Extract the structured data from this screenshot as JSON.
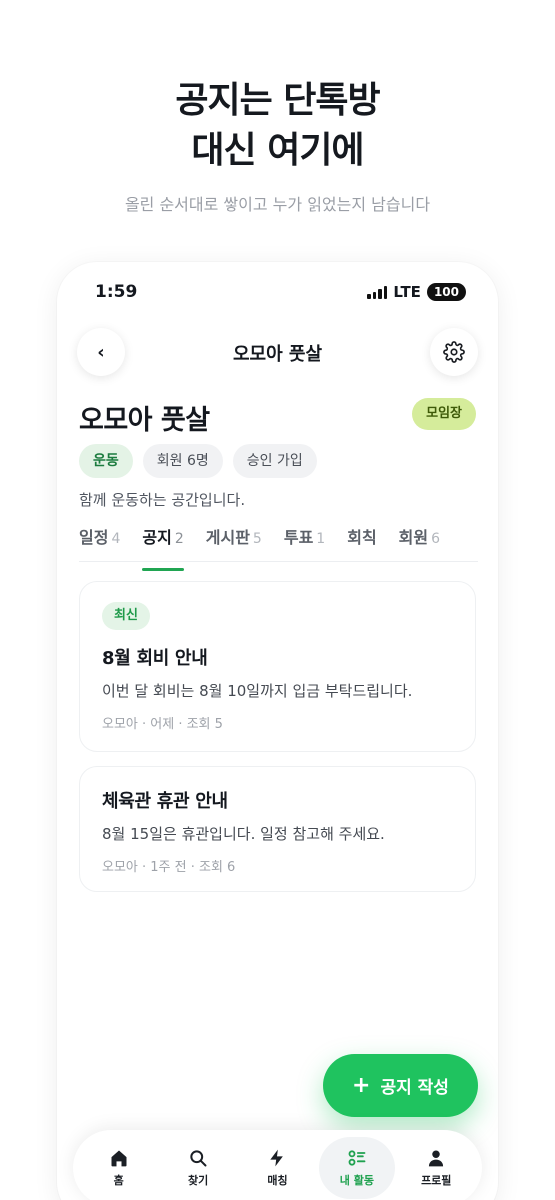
{
  "promo": {
    "headline_line1": "공지는 단톡방",
    "headline_line2": "대신 여기에",
    "subline": "올린 순서대로 쌓이고 누가 읽었는지 남습니다"
  },
  "status_bar": {
    "time": "1:59",
    "network": "LTE",
    "battery": "100"
  },
  "header": {
    "back_label": "‹",
    "title": "오모아 풋살"
  },
  "group": {
    "name": "오모아 풋살",
    "role_badge": "모임장",
    "chips": [
      "운동",
      "회원 6명",
      "승인 가입"
    ],
    "description": "함께 운동하는 공간입니다."
  },
  "tabs": [
    {
      "label": "일정",
      "count": "4"
    },
    {
      "label": "공지",
      "count": "2",
      "active": true
    },
    {
      "label": "게시판",
      "count": "5"
    },
    {
      "label": "투표",
      "count": "1"
    },
    {
      "label": "회칙",
      "count": ""
    },
    {
      "label": "회원",
      "count": "6"
    }
  ],
  "notices": [
    {
      "badge": "최신",
      "title": "8월 회비 안내",
      "body": "이번 달 회비는 8월 10일까지 입금 부탁드립니다.",
      "meta": "오모아 · 어제 · 조회 5"
    },
    {
      "title": "체육관 휴관 안내",
      "body": "8월 15일은 휴관입니다. 일정 참고해 주세요.",
      "meta": "오모아 · 1주 전 · 조회 6"
    }
  ],
  "fab": {
    "icon": "+",
    "label": "공지 작성"
  },
  "bottom_nav": [
    {
      "label": "홈",
      "icon": "home-icon"
    },
    {
      "label": "찾기",
      "icon": "search-icon"
    },
    {
      "label": "매칭",
      "icon": "lightning-icon"
    },
    {
      "label": "내 활동",
      "icon": "activity-icon",
      "active": true
    },
    {
      "label": "프로필",
      "icon": "person-icon"
    }
  ],
  "colors": {
    "accent": "#1fc35f",
    "accent_dark": "#20a552",
    "role_badge": "#d5ec9b"
  }
}
